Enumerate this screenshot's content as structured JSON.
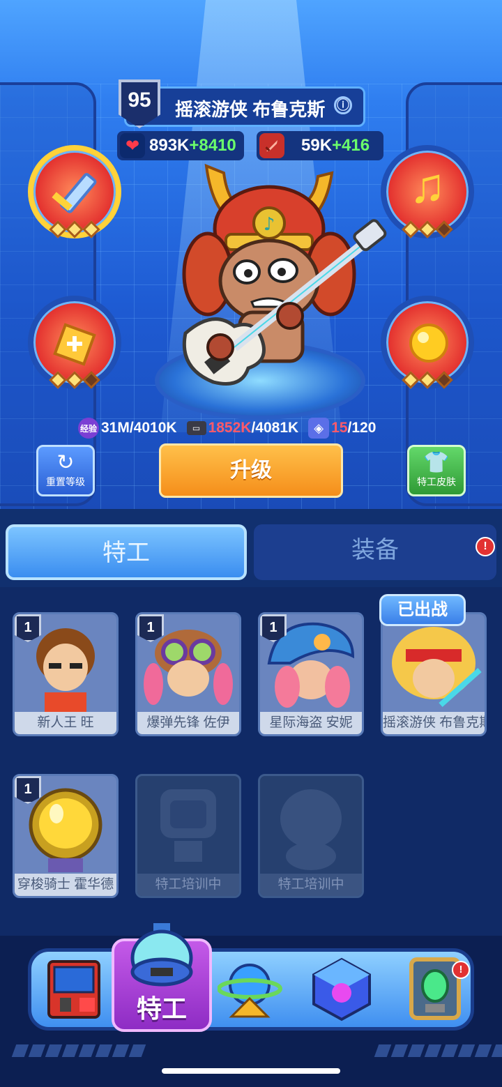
{
  "hero": {
    "level": "95",
    "name": "摇滚游侠 布鲁克斯",
    "info_icon": "ⓘ",
    "hp": {
      "icon": "heart-icon",
      "value": "893K",
      "bonus": "+8410"
    },
    "attack": {
      "icon": "sword-icon",
      "value": "59K",
      "bonus": "+416"
    },
    "skills": [
      {
        "icon": "sword-skill-icon",
        "glyph": "🗡"
      },
      {
        "icon": "music-note-skill-icon",
        "glyph": "♫"
      },
      {
        "icon": "shield-plus-skill-icon",
        "glyph": "✚"
      },
      {
        "icon": "gold-orb-skill-icon",
        "glyph": "●"
      }
    ],
    "resources": {
      "exp_label": "经验",
      "exp": "31M/4010K",
      "tape_current": "1852K",
      "tape_total": "/4081K",
      "chip_current": "15",
      "chip_total": "/120"
    },
    "reset_label": "重置等级",
    "upgrade_label": "升级",
    "skin_label": "特工皮肤"
  },
  "tabs": {
    "agents": "特工",
    "equipment": "装备",
    "alert": "!"
  },
  "agents": {
    "deployed_badge": "已出战",
    "cards": [
      {
        "name": "新人王 旺",
        "level": "1"
      },
      {
        "name": "爆弹先锋 佐伊",
        "level": "1"
      },
      {
        "name": "星际海盗 安妮",
        "level": "1"
      },
      {
        "name": "摇滚游侠 布鲁克斯",
        "level": ""
      },
      {
        "name": "穿梭骑士 霍华德",
        "level": "1"
      },
      {
        "name": "特工培训中",
        "level": ""
      },
      {
        "name": "特工培训中",
        "level": ""
      }
    ]
  },
  "nav": {
    "items": [
      "arcade-machine-icon",
      "agent-capsule-icon",
      "planet-icon",
      "cube-icon",
      "crystal-frame-icon"
    ],
    "active_label": "特工",
    "alert": "!"
  },
  "colors": {
    "accent": "#f9a22c",
    "tab_active": "#3a8df0",
    "alert": "#e23232",
    "bonus_green": "#6bff6b"
  }
}
